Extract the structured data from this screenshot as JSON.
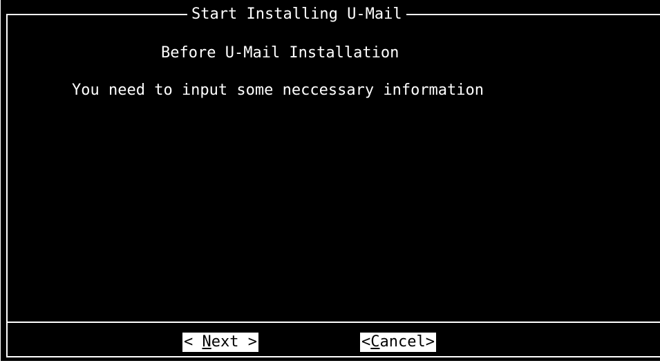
{
  "dialog": {
    "title": "Start Installing U-Mail",
    "heading": "Before U-Mail Installation",
    "message": "You need to input some neccessary information"
  },
  "buttons": {
    "next": {
      "prefix": "< ",
      "accelerator": "N",
      "rest": "ext >"
    },
    "cancel": {
      "prefix": "<",
      "accelerator": "C",
      "rest": "ancel>"
    }
  },
  "colors": {
    "background": "#000000",
    "foreground": "#ffffff",
    "button_background": "#ffffff",
    "button_text": "#000000"
  }
}
